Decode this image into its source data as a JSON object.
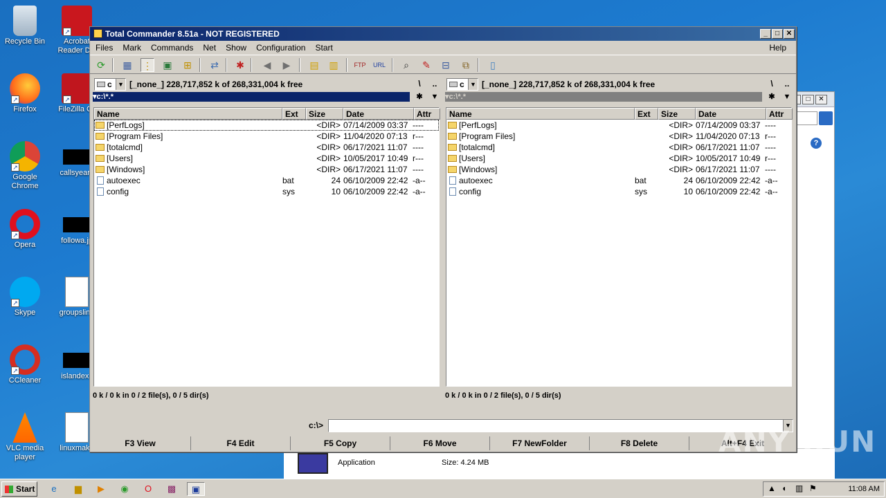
{
  "desktop": {
    "icons": [
      {
        "label": "Recycle Bin"
      },
      {
        "label": "Acrobat Reader DC"
      },
      {
        "label": "Firefox"
      },
      {
        "label": "FileZilla Cli"
      },
      {
        "label": "Google Chrome"
      },
      {
        "label": "callsyears"
      },
      {
        "label": "Opera"
      },
      {
        "label": "followa.jp"
      },
      {
        "label": "Skype"
      },
      {
        "label": "groupsline"
      },
      {
        "label": "CCleaner"
      },
      {
        "label": "islandex.j"
      },
      {
        "label": "VLC media player"
      },
      {
        "label": "linuxmake"
      }
    ]
  },
  "background_window": {
    "file_type": "Application",
    "file_size": "Size: 4.24 MB"
  },
  "tc": {
    "title": "Total Commander 8.51a - NOT REGISTERED",
    "menu": [
      "Files",
      "Mark",
      "Commands",
      "Net",
      "Show",
      "Configuration",
      "Start"
    ],
    "help": "Help",
    "columns": {
      "name": "Name",
      "ext": "Ext",
      "size": "Size",
      "date": "Date",
      "attr": "Attr"
    },
    "left": {
      "drive": "c",
      "drive_info": "[_none_]  228,717,852 k of 268,331,004 k free",
      "root": "\\",
      "up": "..",
      "path": "c:\\*.*",
      "status": "0 k / 0 k in 0 / 2 file(s), 0 / 5 dir(s)"
    },
    "right": {
      "drive": "c",
      "drive_info": "[_none_]  228,717,852 k of 268,331,004 k free",
      "root": "\\",
      "up": "..",
      "path": "c:\\*.*",
      "status": "0 k / 0 k in 0 / 2 file(s), 0 / 5 dir(s)"
    },
    "files": [
      {
        "name": "[PerfLogs]",
        "ext": "",
        "size": "<DIR>",
        "date": "07/14/2009 03:37",
        "attr": "----",
        "type": "dir"
      },
      {
        "name": "[Program Files]",
        "ext": "",
        "size": "<DIR>",
        "date": "11/04/2020 07:13",
        "attr": "r---",
        "type": "dir"
      },
      {
        "name": "[totalcmd]",
        "ext": "",
        "size": "<DIR>",
        "date": "06/17/2021 11:07",
        "attr": "----",
        "type": "dir"
      },
      {
        "name": "[Users]",
        "ext": "",
        "size": "<DIR>",
        "date": "10/05/2017 10:49",
        "attr": "r---",
        "type": "dir"
      },
      {
        "name": "[Windows]",
        "ext": "",
        "size": "<DIR>",
        "date": "06/17/2021 11:07",
        "attr": "----",
        "type": "dir"
      },
      {
        "name": "autoexec",
        "ext": "bat",
        "size": "24",
        "date": "06/10/2009 22:42",
        "attr": "-a--",
        "type": "file"
      },
      {
        "name": "config",
        "ext": "sys",
        "size": "10",
        "date": "06/10/2009 22:42",
        "attr": "-a--",
        "type": "file"
      }
    ],
    "cmd_label": "c:\\>",
    "fkeys": [
      "F3 View",
      "F4 Edit",
      "F5 Copy",
      "F6 Move",
      "F7 NewFolder",
      "F8 Delete",
      "Alt+F4 Exit"
    ]
  },
  "watermark": "ANY RUN",
  "taskbar": {
    "start": "Start",
    "clock": "11:08 AM"
  }
}
